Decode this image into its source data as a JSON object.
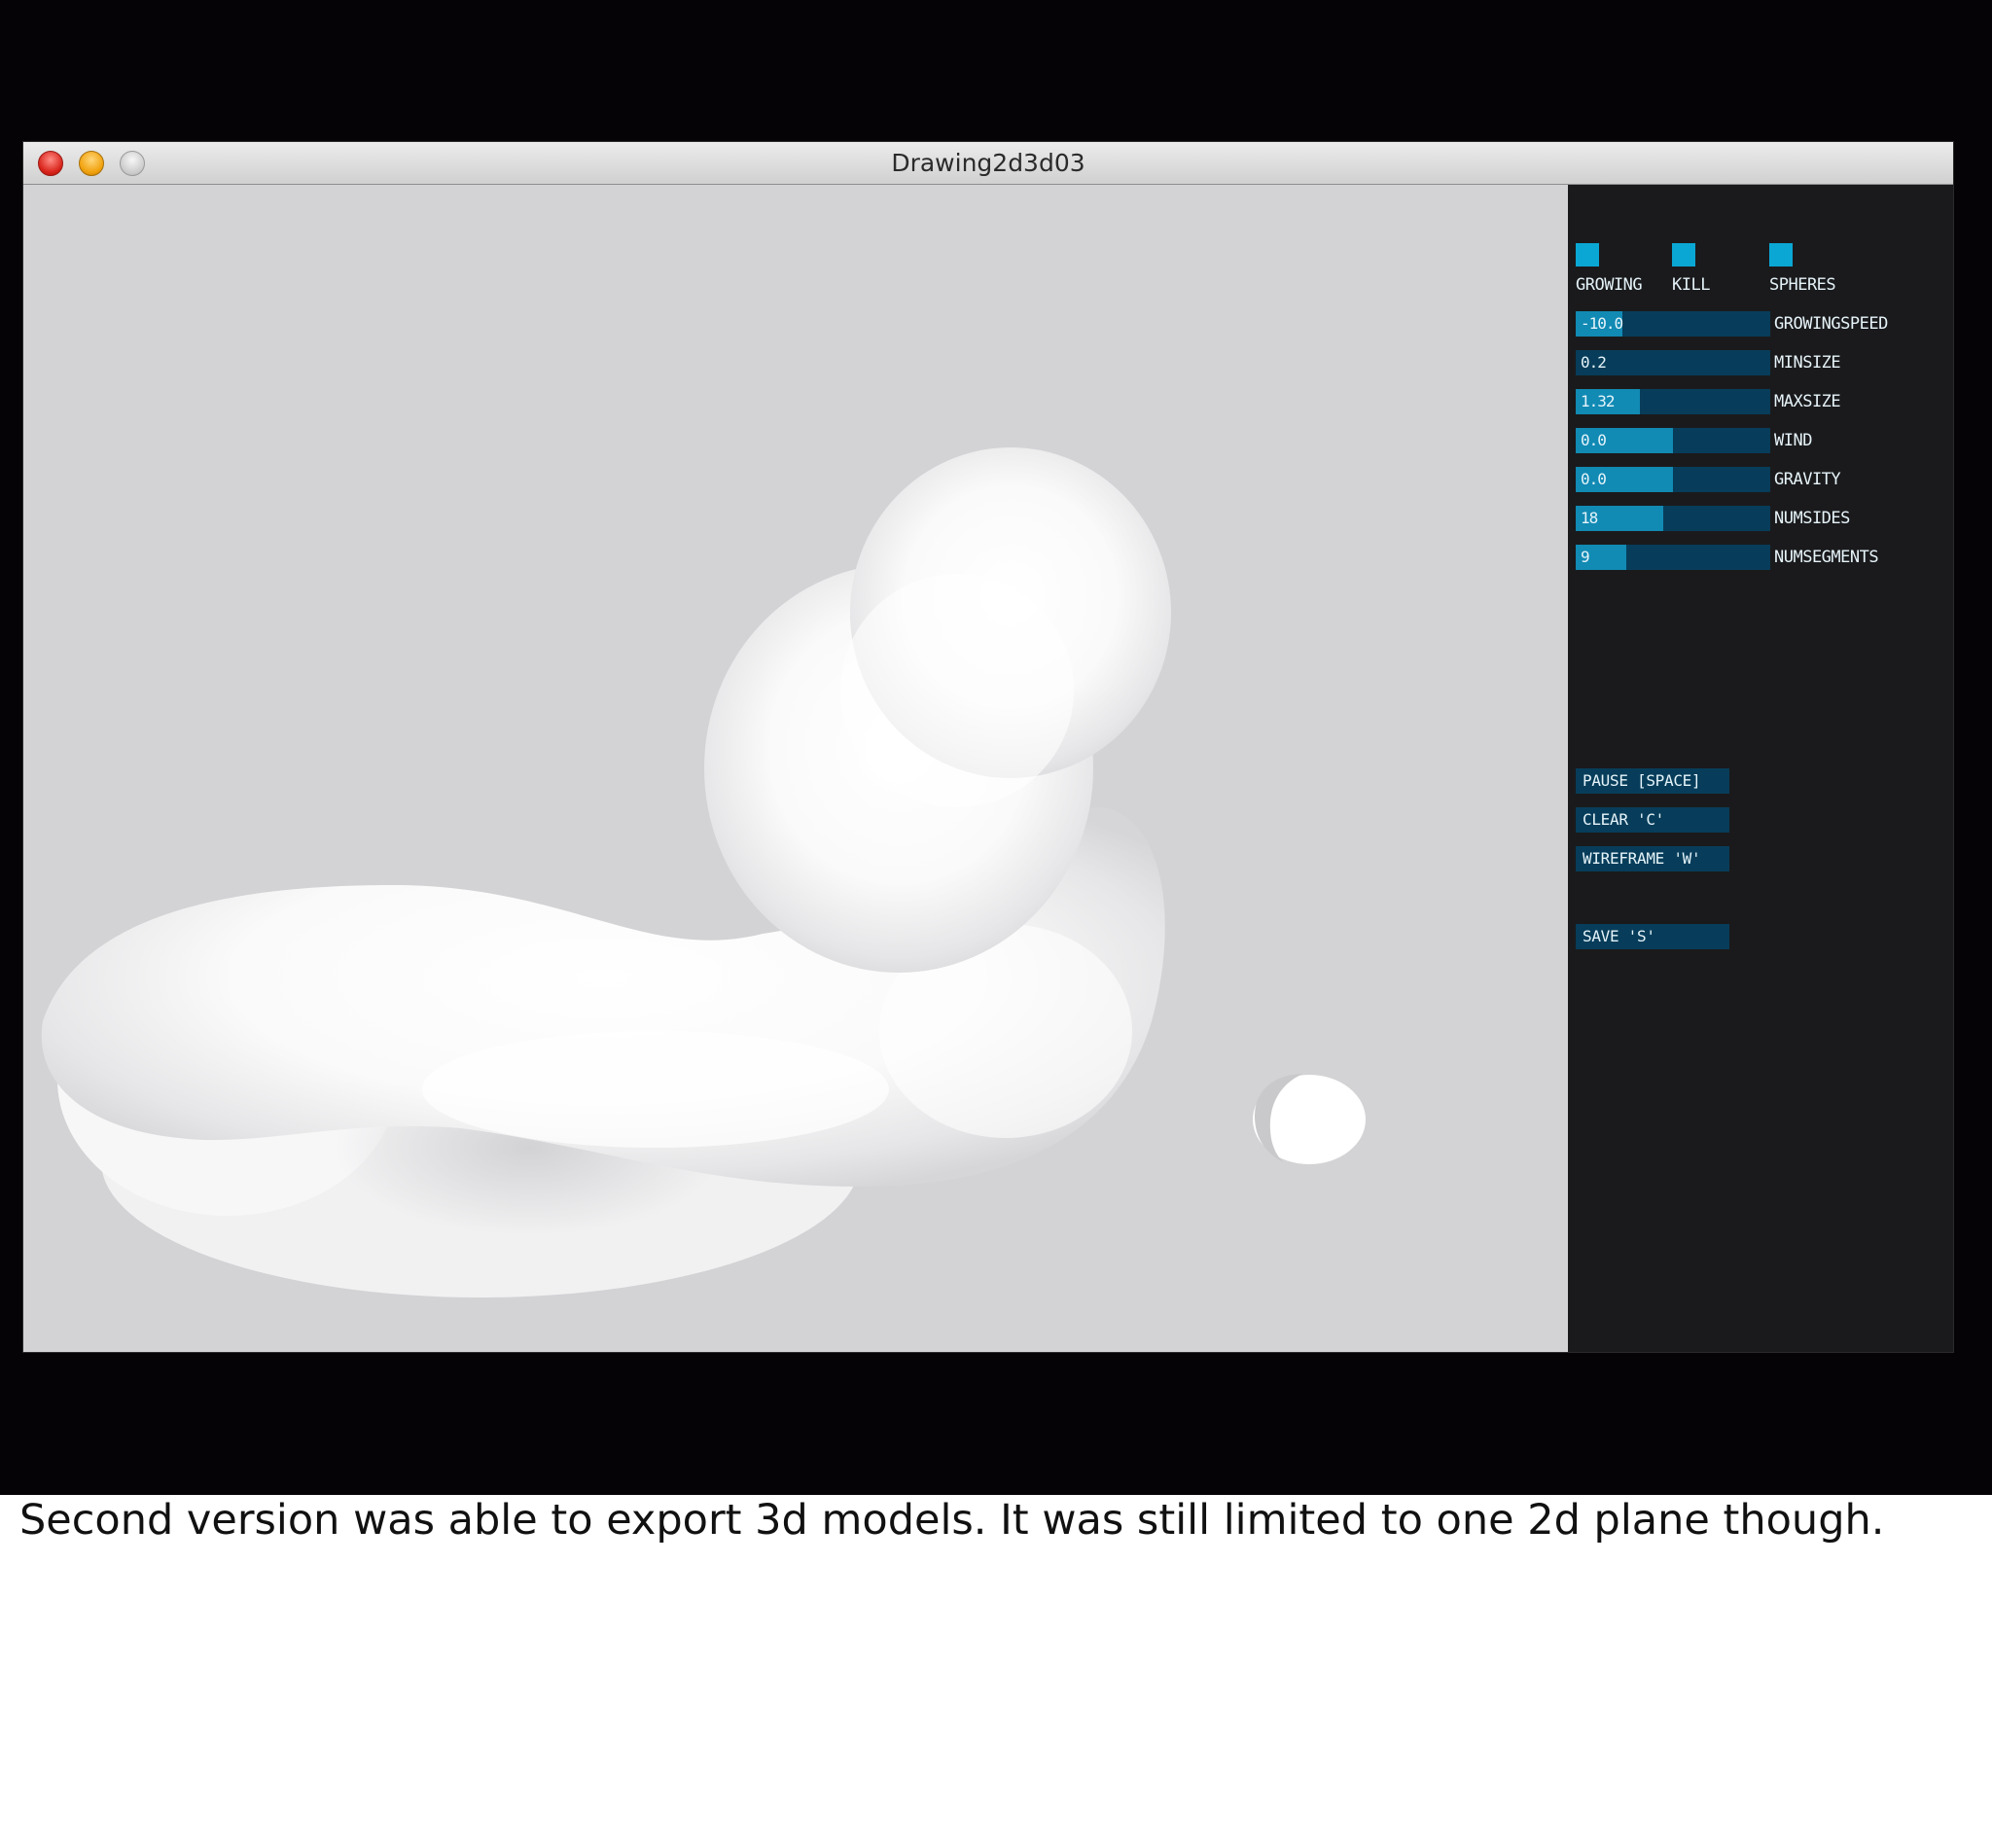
{
  "window": {
    "title": "Drawing2d3d03"
  },
  "controls": {
    "toggles": [
      {
        "label": "GROWING",
        "checked": true
      },
      {
        "label": "KILL",
        "checked": true
      },
      {
        "label": "SPHERES",
        "checked": true
      }
    ],
    "sliders": [
      {
        "value_text": "-10.0",
        "label": "GROWINGSPEED",
        "level": 0.24
      },
      {
        "value_text": "0.2",
        "label": "MINSIZE",
        "level": 0.0
      },
      {
        "value_text": "1.32",
        "label": "MAXSIZE",
        "level": 0.33
      },
      {
        "value_text": "0.0",
        "label": "WIND",
        "level": 0.5
      },
      {
        "value_text": "0.0",
        "label": "GRAVITY",
        "level": 0.5
      },
      {
        "value_text": "18",
        "label": "NUMSIDES",
        "level": 0.45
      },
      {
        "value_text": "9",
        "label": "NUMSEGMENTS",
        "level": 0.26
      }
    ],
    "actions": [
      {
        "label": "PAUSE [SPACE]"
      },
      {
        "label": "CLEAR 'C'"
      },
      {
        "label": "WIREFRAME 'W'"
      },
      {
        "label": "SAVE 'S'"
      }
    ],
    "accent_color": "#0aa7d4",
    "track_color": "#073d5a"
  },
  "caption": "Second version was able to export 3d models. It was still limited to one 2d plane though."
}
